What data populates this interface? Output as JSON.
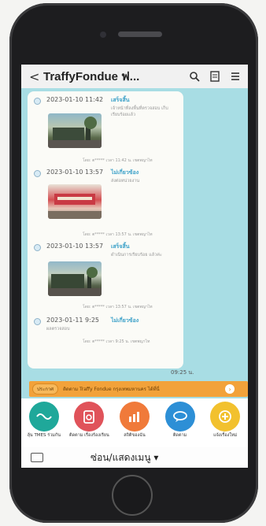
{
  "header": {
    "title": "TraffyFondue ฟ...",
    "back_label": "<"
  },
  "entries": [
    {
      "time": "2023-01-10 11:42",
      "status": "เสร็จสิ้น",
      "desc": "เจ้าหน้าที่ลงพื้นที่ตรวจสอบ เก็บเรียบร้อยแล้ว",
      "footer": "โดย: ต***** เวลา 11:42 น. เขตพญาไท"
    },
    {
      "time": "2023-01-10 13:57",
      "status": "ไม่เกี่ยวข้อง",
      "desc": "ส่งต่อหน่วยงาน",
      "footer": "โดย: ต***** เวลา 13:57 น. เขตพญาไท"
    },
    {
      "time": "2023-01-10 13:57",
      "status": "เสร็จสิ้น",
      "desc": "ดำเนินการเรียบร้อย แล้วค่ะ",
      "footer": "โดย: ต***** เวลา 13:57 น. เขตพญาไท"
    },
    {
      "time": "2023-01-11 9:25",
      "status": "ไม่เกี่ยวข้อง",
      "desc": "ผลตรวจสอบ",
      "footer": "โดย: ต***** เวลา 9:25 น. เขตพญาไท"
    }
  ],
  "last_time": "09:25 น.",
  "ticker": {
    "tag": "ประกาศ",
    "message": "ติดตาม Traffy Fondue กรุงเทพมหานคร ได้ที่นี่"
  },
  "menu": [
    {
      "label": "ลุ้น TMES ร่วมกัน",
      "icon": "map-icon",
      "color": "#1fa89a"
    },
    {
      "label": "ติดตาม เรื่องร้องเรียน",
      "icon": "clipboard-icon",
      "color": "#e0535a"
    },
    {
      "label": "สถิติของฉัน",
      "icon": "chart-icon",
      "color": "#f07a3a"
    },
    {
      "label": "ติดตาม",
      "icon": "chat-icon",
      "color": "#2d8fd6"
    },
    {
      "label": "แจ้งเรื่องใหม่",
      "icon": "plus-icon",
      "color": "#f2c12e"
    }
  ],
  "bottom": {
    "toggle_label": "ซ่อน/แสดงเมนู ▾"
  }
}
